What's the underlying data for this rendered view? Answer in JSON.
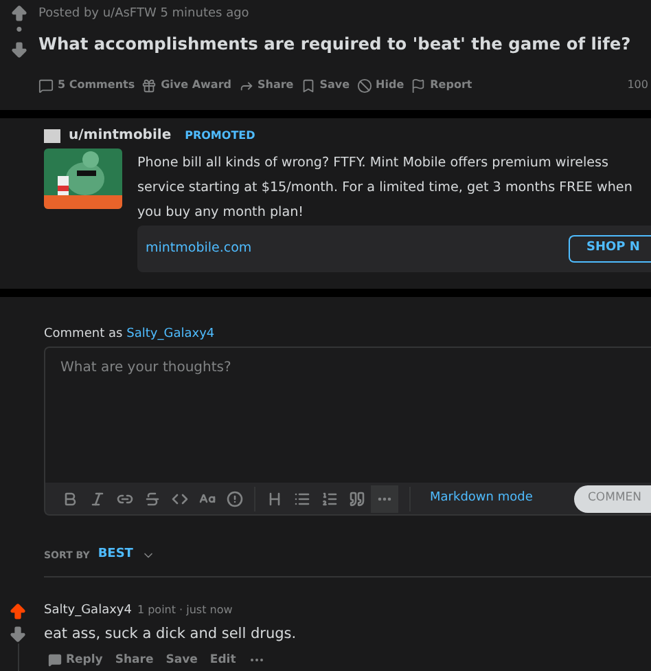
{
  "post": {
    "score": "•",
    "posted_by": "Posted by u/AsFTW 5 minutes ago",
    "title": "What accomplishments are required to 'beat' the game of life?",
    "actions": [
      {
        "kind": "comments",
        "label": "5 Comments"
      },
      {
        "kind": "award",
        "label": "Give Award"
      },
      {
        "kind": "share",
        "label": "Share"
      },
      {
        "kind": "save",
        "label": "Save"
      },
      {
        "kind": "hide",
        "label": "Hide"
      },
      {
        "kind": "report",
        "label": "Report"
      }
    ],
    "ratio": "100"
  },
  "ad": {
    "user": "u/mintmobile",
    "badge": "PROMOTED",
    "text": "Phone bill all kinds of wrong? FTFY. Mint Mobile offers premium wireless service starting at $15/month. For a limited time, get 3 months FREE when you buy any month plan!",
    "domain": "mintmobile.com",
    "cta": "SHOP N"
  },
  "composer": {
    "label": "Comment as",
    "user": "Salty_Galaxy4",
    "placeholder": "What are your thoughts?",
    "tools": [
      {
        "kind": "bold"
      },
      {
        "kind": "italic"
      },
      {
        "kind": "link"
      },
      {
        "kind": "strike"
      },
      {
        "kind": "code"
      },
      {
        "kind": "superscript"
      },
      {
        "kind": "spoiler"
      },
      {
        "kind": "sep"
      },
      {
        "kind": "heading"
      },
      {
        "kind": "bullets"
      },
      {
        "kind": "numbers"
      },
      {
        "kind": "quote"
      },
      {
        "kind": "more"
      }
    ],
    "markdown": "Markdown mode",
    "submit": "COMMEN"
  },
  "sort": {
    "label": "SORT BY",
    "value": "BEST"
  },
  "comments": [
    {
      "author": "Salty_Galaxy4",
      "meta": "1 point · just now",
      "upvoted": true,
      "text": "eat ass, suck a dick and sell drugs.",
      "actions": [
        "Reply",
        "Share",
        "Save",
        "Edit"
      ]
    }
  ]
}
